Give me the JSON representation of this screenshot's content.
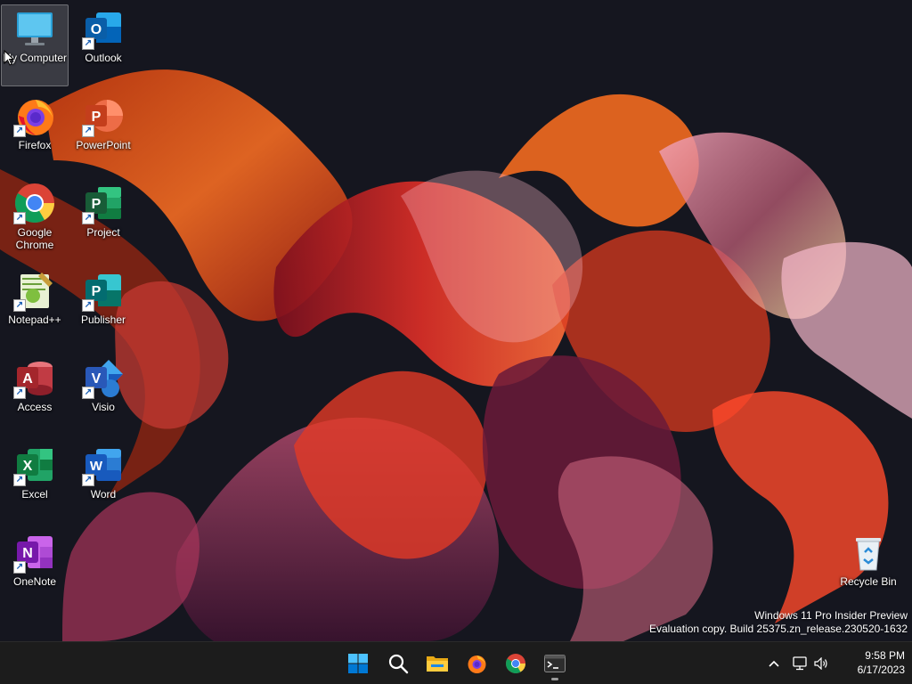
{
  "desktop_icons": [
    {
      "label": "My Computer",
      "icon": "monitor-icon",
      "shortcut": false
    },
    {
      "label": "Outlook",
      "icon": "outlook-icon",
      "shortcut": true
    },
    {
      "label": "Firefox",
      "icon": "firefox-icon",
      "shortcut": true
    },
    {
      "label": "PowerPoint",
      "icon": "powerpoint-icon",
      "shortcut": true
    },
    {
      "label": "Google Chrome",
      "icon": "chrome-icon",
      "shortcut": true
    },
    {
      "label": "Project",
      "icon": "project-icon",
      "shortcut": true
    },
    {
      "label": "Notepad++",
      "icon": "notepadpp-icon",
      "shortcut": true
    },
    {
      "label": "Publisher",
      "icon": "publisher-icon",
      "shortcut": true
    },
    {
      "label": "Access",
      "icon": "access-icon",
      "shortcut": true
    },
    {
      "label": "Visio",
      "icon": "visio-icon",
      "shortcut": true
    },
    {
      "label": "Excel",
      "icon": "excel-icon",
      "shortcut": true
    },
    {
      "label": "Word",
      "icon": "word-icon",
      "shortcut": true
    },
    {
      "label": "OneNote",
      "icon": "onenote-icon",
      "shortcut": true
    },
    {
      "label": "Recycle Bin",
      "icon": "recycle-bin-icon",
      "shortcut": false
    }
  ],
  "watermark": {
    "line1": "Windows 11 Pro Insider Preview",
    "line2": "Evaluation copy. Build 25375.zn_release.230520-1632"
  },
  "taskbar": {
    "apps": [
      "start-icon",
      "search-icon",
      "file-explorer-icon",
      "firefox-icon",
      "chrome-icon",
      "terminal-icon"
    ]
  },
  "clock": {
    "time": "9:58 PM",
    "date": "6/17/2023"
  },
  "colors": {
    "taskbar": "#1c1c1c",
    "background": "#141520",
    "accent": "#0078d4"
  }
}
